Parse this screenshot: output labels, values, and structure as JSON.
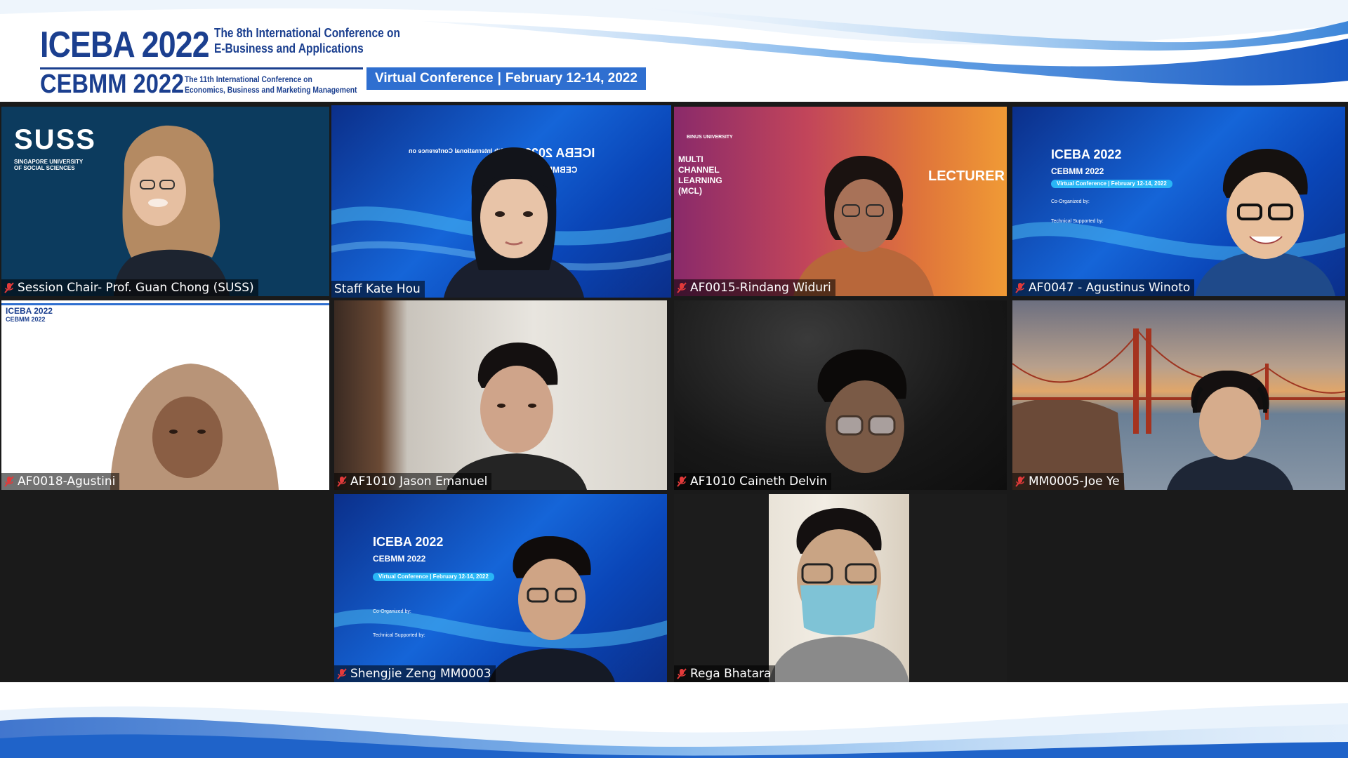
{
  "header": {
    "title_primary": "ICEBA 2022",
    "subtitle_primary_line1": "The 8th International Conference on",
    "subtitle_primary_line2": "E-Business and Applications",
    "title_secondary": "CEBMM 2022",
    "subtitle_secondary_line1": "The 11th International Conference on",
    "subtitle_secondary_line2": "Economics, Business and Marketing Management",
    "venue": "Virtual Conference",
    "dates": "February 12-14, 2022"
  },
  "colors": {
    "brand_blue": "#1b3f8f",
    "badge_blue": "#2f6fd0",
    "active_speaker_border": "#e7e06a",
    "gallery_background": "#1a1a1a"
  },
  "participants": [
    {
      "name": "Session Chair- Prof. Guan Chong (SUSS)",
      "muted": true,
      "active": false,
      "background": "SUSS",
      "background_sub": "SINGAPORE UNIVERSITY OF SOCIAL SCIENCES"
    },
    {
      "name": "Staff Kate Hou",
      "muted": false,
      "active": true,
      "background": "ICEBA 2022 mirrored slide"
    },
    {
      "name": "AF0015-Rindang Widuri",
      "muted": true,
      "active": false,
      "background": "BINUS UNIVERSITY",
      "background_sub": "MULTI CHANNEL LEARNING (MCL)",
      "badge": "LECTURER"
    },
    {
      "name": "AF0047 - Agustinus Winoto",
      "muted": true,
      "active": false,
      "background": "ICEBA 2022 slide"
    },
    {
      "name": "AF0018-Agustini",
      "muted": true,
      "active": false,
      "background": "ICEBA 2022 slide"
    },
    {
      "name": "AF1010 Jason Emanuel",
      "muted": true,
      "active": false,
      "background": "room"
    },
    {
      "name": "AF1010 Caineth Delvin",
      "muted": true,
      "active": false,
      "background": "dark room"
    },
    {
      "name": "MM0005-Joe Ye",
      "muted": true,
      "active": false,
      "background": "Golden Gate Bridge"
    },
    {
      "name": "Shengjie Zeng MM0003",
      "muted": true,
      "active": false,
      "background": "ICEBA 2022 slide"
    },
    {
      "name": "Rega Bhatara",
      "muted": true,
      "active": false,
      "background": "room"
    }
  ],
  "slide": {
    "title1": "ICEBA 2022",
    "title2": "CEBMM 2022",
    "sub1": "The 8th International Conference on",
    "sub2": "E-Business and Applications",
    "sub3": "The 11th International Conference on",
    "sub4": "Economics, Business and Marketing Management",
    "pill": "Virtual Conference | February 12-14, 2022",
    "coorg": "Co-Organized by:",
    "tech": "Technical Supported by:"
  },
  "suss": {
    "logo": "SUSS",
    "line1": "SINGAPORE UNIVERSITY",
    "line2": "OF SOCIAL SCIENCES"
  },
  "binus": {
    "univ": "BINUS UNIVERSITY",
    "mcl1": "MULTI",
    "mcl2": "CHANNEL",
    "mcl3": "LEARNING",
    "mcl4": "(MCL)",
    "lecturer": "LECTURER"
  }
}
